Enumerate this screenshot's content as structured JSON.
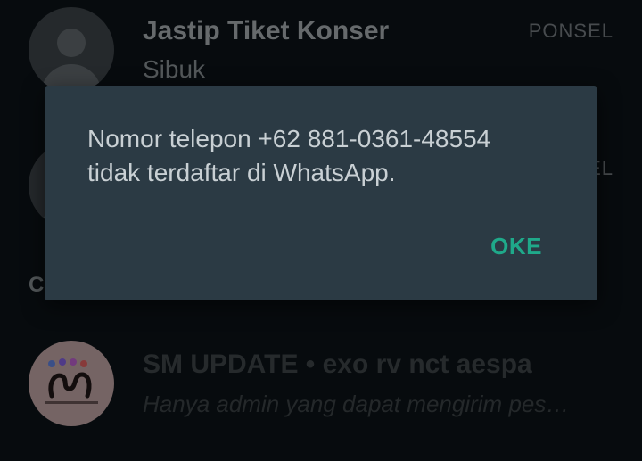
{
  "contacts": [
    {
      "name": "Jastip Tiket Konser",
      "status": "Sibuk",
      "type": "PONSEL"
    },
    {
      "type": "PONSEL"
    }
  ],
  "section_label": "C",
  "group": {
    "name": "SM UPDATE • exo rv nct aespa",
    "description": "Hanya admin yang dapat mengirim pes…"
  },
  "dialog": {
    "message_line1": "Nomor telepon +62 881-0361-48554",
    "message_line2": "tidak terdaftar di WhatsApp.",
    "ok_label": "OKE"
  },
  "colors": {
    "accent": "#1fa98a",
    "dialog_bg": "#2b3a44",
    "screen_bg": "#0b1116"
  }
}
